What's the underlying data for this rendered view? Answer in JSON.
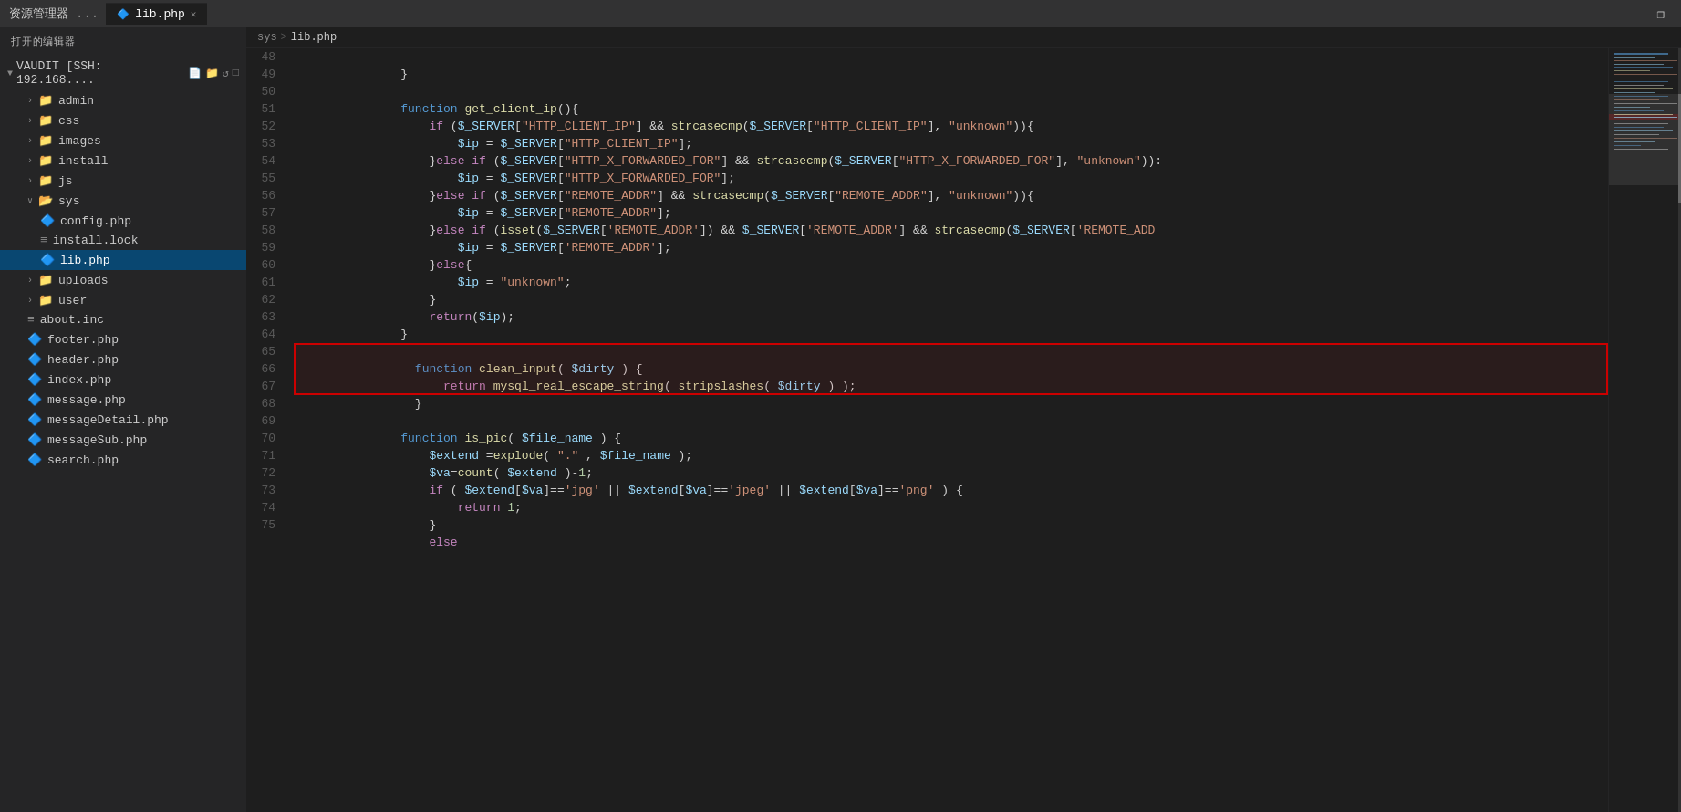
{
  "titlebar": {
    "explorer_label": "资源管理器",
    "more_icon": "...",
    "tab_filename": "lib.php",
    "close_icon": "✕",
    "window_restore": "❐"
  },
  "breadcrumb": {
    "root": "sys",
    "separator": ">",
    "file": "lib.php"
  },
  "sidebar": {
    "header": "打开的编辑器",
    "root_label": "VAUDIT [SSH: 192.168....",
    "root_icons": [
      "📄",
      "📁",
      "↺",
      "□"
    ],
    "items": [
      {
        "id": "admin",
        "label": "admin",
        "type": "folder",
        "indent": 1,
        "collapsed": true
      },
      {
        "id": "css",
        "label": "css",
        "type": "folder",
        "indent": 1,
        "collapsed": true
      },
      {
        "id": "images",
        "label": "images",
        "type": "folder",
        "indent": 1,
        "collapsed": true
      },
      {
        "id": "install",
        "label": "install",
        "type": "folder",
        "indent": 1,
        "collapsed": true
      },
      {
        "id": "js",
        "label": "js",
        "type": "folder",
        "indent": 1,
        "collapsed": true
      },
      {
        "id": "sys",
        "label": "sys",
        "type": "folder",
        "indent": 1,
        "collapsed": false
      },
      {
        "id": "config.php",
        "label": "config.php",
        "type": "php",
        "indent": 2
      },
      {
        "id": "install.lock",
        "label": "install.lock",
        "type": "lock",
        "indent": 2
      },
      {
        "id": "lib.php",
        "label": "lib.php",
        "type": "php",
        "indent": 2,
        "active": true
      },
      {
        "id": "uploads",
        "label": "uploads",
        "type": "folder",
        "indent": 1,
        "collapsed": true
      },
      {
        "id": "user",
        "label": "user",
        "type": "folder",
        "indent": 1,
        "collapsed": true
      },
      {
        "id": "about.inc",
        "label": "about.inc",
        "type": "inc",
        "indent": 1
      },
      {
        "id": "footer.php",
        "label": "footer.php",
        "type": "php",
        "indent": 1
      },
      {
        "id": "header.php",
        "label": "header.php",
        "type": "php",
        "indent": 1
      },
      {
        "id": "index.php",
        "label": "index.php",
        "type": "php",
        "indent": 1
      },
      {
        "id": "message.php",
        "label": "message.php",
        "type": "php",
        "indent": 1
      },
      {
        "id": "messageDetail.php",
        "label": "messageDetail.php",
        "type": "php",
        "indent": 1
      },
      {
        "id": "messageSub.php",
        "label": "messageSub.php",
        "type": "php",
        "indent": 1
      },
      {
        "id": "search.php",
        "label": "search.php",
        "type": "php",
        "indent": 1
      }
    ]
  },
  "code": {
    "lines": [
      {
        "num": 48,
        "content": "    }"
      },
      {
        "num": 49,
        "content": ""
      },
      {
        "num": 50,
        "content": "    function get_client_ip(){"
      },
      {
        "num": 51,
        "content": "        if ($_SERVER[\"HTTP_CLIENT_IP\"] && strcasecmp($_SERVER[\"HTTP_CLIENT_IP\"], \"unknown\")){"
      },
      {
        "num": 52,
        "content": "            $ip = $_SERVER[\"HTTP_CLIENT_IP\"];"
      },
      {
        "num": 53,
        "content": "        }else if ($_SERVER[\"HTTP_X_FORWARDED_FOR\"] && strcasecmp($_SERVER[\"HTTP_X_FORWARDED_FOR\"], \"unknown\")):"
      },
      {
        "num": 54,
        "content": "            $ip = $_SERVER[\"HTTP_X_FORWARDED_FOR\"];"
      },
      {
        "num": 55,
        "content": "        }else if ($_SERVER[\"REMOTE_ADDR\"] && strcasecmp($_SERVER[\"REMOTE_ADDR\"], \"unknown\")){"
      },
      {
        "num": 56,
        "content": "            $ip = $_SERVER[\"REMOTE_ADDR\"];"
      },
      {
        "num": 57,
        "content": "        }else if (isset($_SERVER['REMOTE_ADDR']) && $_SERVER['REMOTE_ADDR'] && strcasecmp($_SERVER['REMOTE_ADD"
      },
      {
        "num": 58,
        "content": "            $ip = $_SERVER['REMOTE_ADDR'];"
      },
      {
        "num": 59,
        "content": "        }else{"
      },
      {
        "num": 60,
        "content": "            $ip = \"unknown\";"
      },
      {
        "num": 61,
        "content": "        }"
      },
      {
        "num": 62,
        "content": "        return($ip);"
      },
      {
        "num": 63,
        "content": "    }"
      },
      {
        "num": 64,
        "content": ""
      },
      {
        "num": 65,
        "content": "    function clean_input( $dirty ) {",
        "highlight": true
      },
      {
        "num": 66,
        "content": "        return mysql_real_escape_string( stripslashes( $dirty ) );",
        "highlight": true
      },
      {
        "num": 67,
        "content": "    }",
        "highlight": true
      },
      {
        "num": 68,
        "content": ""
      },
      {
        "num": 69,
        "content": "    function is_pic( $file_name ) {"
      },
      {
        "num": 70,
        "content": "        $extend =explode( \".\" , $file_name );"
      },
      {
        "num": 71,
        "content": "        $va=count( $extend )-1;"
      },
      {
        "num": 72,
        "content": "        if ( $extend[$va]=='jpg' || $extend[$va]=='jpeg' || $extend[$va]=='png' ) {"
      },
      {
        "num": 73,
        "content": "            return 1;"
      },
      {
        "num": 74,
        "content": "        }"
      },
      {
        "num": 75,
        "content": "        else"
      }
    ]
  }
}
